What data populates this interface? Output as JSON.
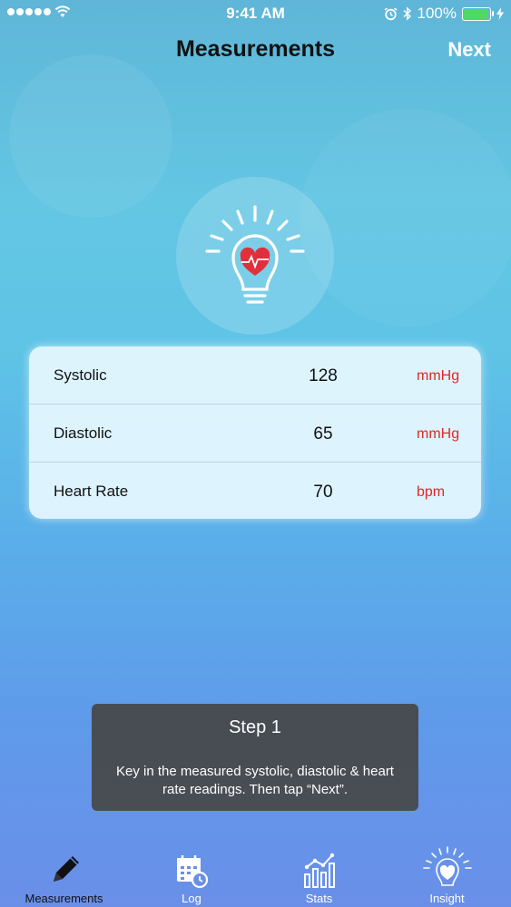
{
  "status_bar": {
    "time": "9:41 AM",
    "battery": "100%"
  },
  "nav": {
    "title": "Measurements",
    "next_label": "Next"
  },
  "measurements": [
    {
      "label": "Systolic",
      "value": "128",
      "unit": "mmHg"
    },
    {
      "label": "Diastolic",
      "value": "65",
      "unit": "mmHg"
    },
    {
      "label": "Heart Rate",
      "value": "70",
      "unit": "bpm"
    }
  ],
  "tooltip": {
    "title": "Step 1",
    "body": "Key in the measured systolic, diastolic & heart rate readings. Then tap “Next”."
  },
  "tabs": [
    {
      "label": "Measurements",
      "icon": "pencil-icon",
      "active": true
    },
    {
      "label": "Log",
      "icon": "calendar-clock-icon",
      "active": false
    },
    {
      "label": "Stats",
      "icon": "bar-chart-icon",
      "active": false
    },
    {
      "label": "Insight",
      "icon": "lightbulb-heart-icon",
      "active": false
    }
  ],
  "colors": {
    "accent_red": "#e5252b",
    "battery_green": "#4cd964",
    "tooltip_bg": "#464646"
  }
}
